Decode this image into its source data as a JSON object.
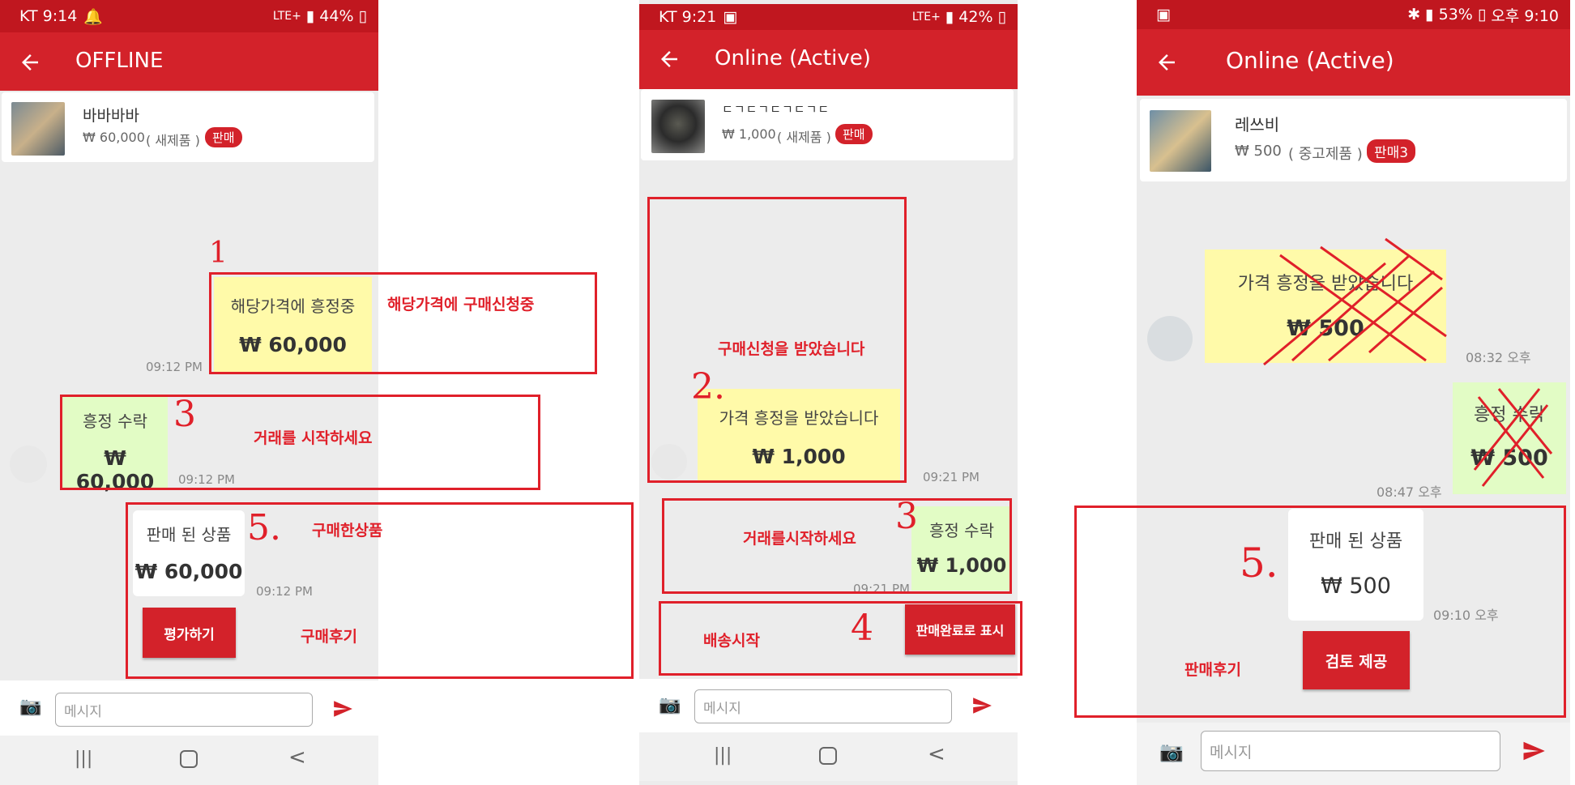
{
  "colors": {
    "brand": "#d3222a",
    "status_bar": "#c0171f",
    "annotation": "#e0202a",
    "received_bubble": "#fffaa9",
    "accepted_bubble": "#e2fcc5",
    "chat_bg": "#ececec"
  },
  "screen1": {
    "status": {
      "carrier_time": "KT 9:14",
      "battery": "44%",
      "network": "LTE+"
    },
    "title": "OFFLINE",
    "product": {
      "name": "바바바바",
      "price": "₩ 60,000",
      "condition": "( 새제품 )",
      "badge": "판매"
    },
    "messages": {
      "m1": {
        "text": "해당가격에 흥정중",
        "amount": "₩ 60,000",
        "time": "09:12 PM"
      },
      "m2": {
        "text": "흥정 수락",
        "amount": "₩ 60,000",
        "time": "09:12 PM"
      },
      "m3": {
        "text": "판매 된 상품",
        "amount": "₩ 60,000",
        "time": "09:12 PM"
      },
      "review_button": "평가하기"
    },
    "input_placeholder": "메시지",
    "annotations": {
      "n1": "1",
      "a1": "해당가격에 구매신청중",
      "n3": "3",
      "a3": "거래를 시작하세요",
      "n5": "5.",
      "a5": "구매한상품",
      "review": "구매후기"
    }
  },
  "screen2": {
    "status": {
      "carrier_time": "KT 9:21",
      "battery": "42%",
      "network": "LTE+"
    },
    "title": "Online (Active)",
    "product": {
      "name": "ㄷㄱㄷㄱㄷㄱㄷㄱㄷ",
      "price": "₩ 1,000",
      "condition": "( 새제품 )",
      "badge": "판매"
    },
    "messages": {
      "m1": {
        "text": "가격 흥정을 받았습니다",
        "amount": "₩ 1,000",
        "time": "09:21 PM"
      },
      "m2": {
        "text": "흥정 수락",
        "amount": "₩ 1,000",
        "time": "09:21 PM"
      },
      "complete_button": "판매완료로 표시"
    },
    "input_placeholder": "메시지",
    "annotations": {
      "a_received": "구매신청을 받았습니다",
      "n2": "2.",
      "a3": "거래를시작하세요",
      "n3": "3",
      "a4": "배송시작",
      "n4": "4"
    }
  },
  "screen3": {
    "status": {
      "time": "오후 9:10",
      "battery": "53%"
    },
    "title": "Online (Active)",
    "product": {
      "name": "레쓰비",
      "price": "₩ 500",
      "condition": "( 중고제품 )",
      "badge": "판매3"
    },
    "messages": {
      "m1": {
        "text": "가격 흥정을 받았습니다",
        "amount": "₩ 500",
        "time": "08:32 오후"
      },
      "m2": {
        "text": "흥정 수락",
        "amount": "₩ 500",
        "time": "08:47 오후"
      },
      "m3": {
        "text": "판매 된 상품",
        "amount": "₩ 500",
        "time": "09:10 오후"
      },
      "review_button": "검토 제공"
    },
    "input_placeholder": "메시지",
    "annotations": {
      "n5": "5.",
      "review": "판매후기"
    }
  }
}
